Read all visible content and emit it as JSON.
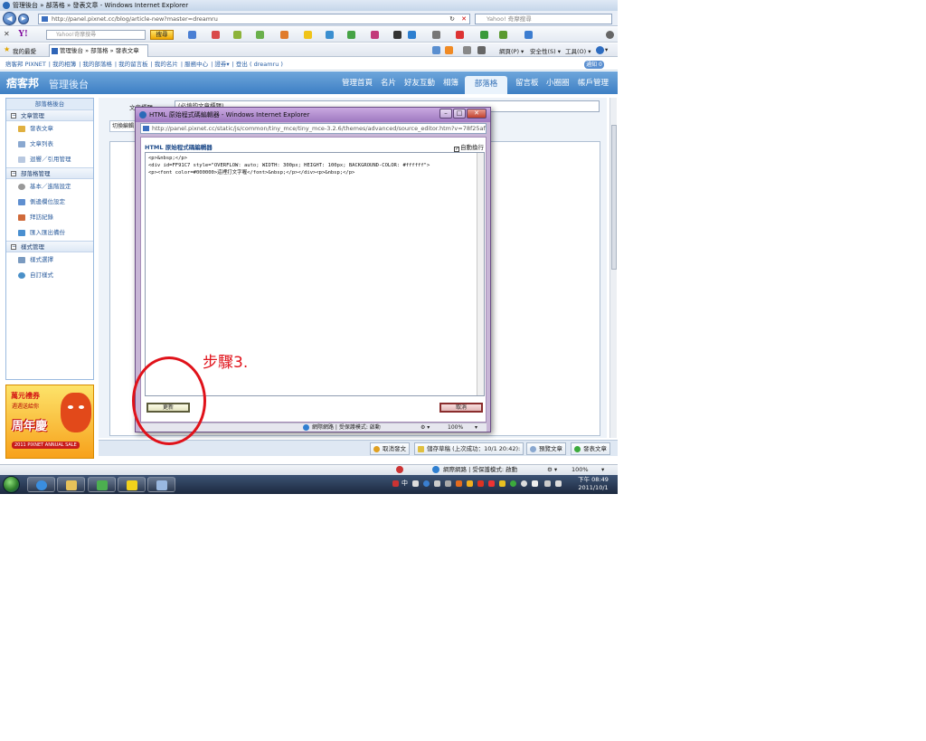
{
  "window": {
    "title": "管理後台 » 部落格 » 發表文章 - Windows Internet Explorer",
    "url": "http://panel.pixnet.cc/blog/article-new?master=dreamru",
    "search_placeholder": "Yahoo! 奇摩搜尋"
  },
  "toolbar": {
    "search_placeholder": "Yahoo!奇摩搜尋",
    "search_button": "搜尋",
    "cmd_page": "網頁(P) ▾",
    "cmd_safety": "安全性(S) ▾",
    "cmd_tools": "工具(O) ▾",
    "cmd_help": "▾"
  },
  "favorites": {
    "label": "我的最愛",
    "tab_title": "管理後台 » 部落格 » 發表文章"
  },
  "site_links": {
    "items": [
      "痞客邦 PIXNET",
      "我的相簿",
      "我的部落格",
      "我的留言板",
      "我的名片",
      "服務中心",
      "證券▾",
      "登出 ( dreamru )"
    ],
    "notice": "通知 0"
  },
  "header": {
    "logo": "痞客邦",
    "subtitle": "管理後台",
    "nav": [
      "管理首頁",
      "名片",
      "好友互動",
      "相簿",
      "部落格",
      "留言板",
      "小圈圈",
      "帳戶管理"
    ]
  },
  "sidebar": {
    "title": "部落格後台",
    "sections": [
      {
        "label": "文章管理",
        "items": [
          "發表文章",
          "文章列表",
          "迴響／引用管理"
        ]
      },
      {
        "label": "部落格管理",
        "items": [
          "基本／進階設定",
          "側邊欄位設定",
          "拜訪紀錄",
          "匯入匯出備份"
        ]
      },
      {
        "label": "樣式管理",
        "items": [
          "樣式選擇",
          "自訂樣式"
        ]
      }
    ]
  },
  "promo": {
    "line1": "萬元禮券",
    "line2": "週週送給你",
    "line3": "周年慶",
    "line4": "2011 PIXNET ANNUAL SALE"
  },
  "editor": {
    "title_label": "文章標題",
    "title_value": "(必填的文章標題)",
    "switch_tab": "切換編輯"
  },
  "actions": {
    "cancel": "取消發文",
    "save_draft": "儲存草稿 (上次成功：10/1 20:42):",
    "preview": "預覽文章",
    "publish": "發表文章"
  },
  "ie_status": {
    "zone": "網際網路 | 受保護模式: 啟動",
    "zoom": "100%"
  },
  "popup": {
    "title": "HTML 原始程式碼編輯器 - Windows Internet Explorer",
    "url": "http://panel.pixnet.cc/static/js/common/tiny_mce/tiny_mce-3.2.6/themes/advanced/source_editor.htm?v=78f25afad4a",
    "heading": "HTML 原始程式碼編輯器",
    "wrap_label": "自動換行",
    "code_lines": [
      "<p>&nbsp;</p>",
      "<div id=FF91C7 style=\"OVERFLOW: auto; WIDTH: 300px; HEIGHT: 100px; BACKGROUND-COLOR: #ffffff\">",
      "<p><font color=#000000>這裡打文字喔</font>&nbsp;</p></div><p>&nbsp;</p>"
    ],
    "update_button": "更新",
    "cancel_button": "取消",
    "status_zone": "網際網路 | 受保護模式: 啟動",
    "status_zoom": "100%"
  },
  "annotation": {
    "step_text": "步驟3."
  },
  "taskbar": {
    "time": "下午 08:49",
    "date": "2011/10/1",
    "lang": "中"
  }
}
